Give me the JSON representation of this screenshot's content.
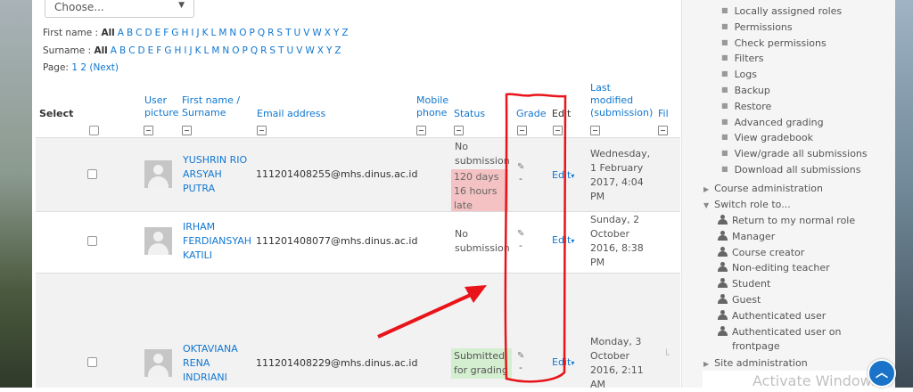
{
  "filter": {
    "select_text": "Choose..."
  },
  "initials": {
    "firstname_label": "First name :",
    "surname_label": "Surname :",
    "all": "All",
    "letters": [
      "A",
      "B",
      "C",
      "D",
      "E",
      "F",
      "G",
      "H",
      "I",
      "J",
      "K",
      "L",
      "M",
      "N",
      "O",
      "P",
      "Q",
      "R",
      "S",
      "T",
      "U",
      "V",
      "W",
      "X",
      "Y",
      "Z"
    ]
  },
  "paging": {
    "label": "Page:",
    "pages": "1 2",
    "next": "(Next)"
  },
  "table": {
    "headers": {
      "select": "Select",
      "user_picture_1": "User",
      "user_picture_2": "picture",
      "name_1": "First name /",
      "name_2": "Surname",
      "email": "Email address",
      "mobile_1": "Mobile",
      "mobile_2": "phone",
      "status": "Status",
      "grade": "Grade",
      "edit": "Edit",
      "modified_1": "Last",
      "modified_2": "modified",
      "modified_3": "(submission)",
      "file": "Fil"
    },
    "rows": [
      {
        "name": [
          "YUSHRIN RIO",
          "ARSYAH",
          "PUTRA"
        ],
        "email": "111201408255@mhs.dinus.ac.id",
        "status": [
          "No",
          "submission"
        ],
        "late": [
          "120 days",
          "16 hours",
          "late"
        ],
        "grade": "-",
        "edit": "Edit",
        "date": [
          "Wednesday,",
          "1 February",
          "2017, 4:04",
          "PM"
        ]
      },
      {
        "name": [
          "IRHAM",
          "FERDIANSYAH",
          "KATILI"
        ],
        "email": "111201408077@mhs.dinus.ac.id",
        "status": [
          "No",
          "submission"
        ],
        "grade": "-",
        "edit": "Edit",
        "date": [
          "Sunday, 2",
          "October",
          "2016, 8:38",
          "PM"
        ]
      },
      {
        "name": [
          "OKTAVIANA",
          "RENA",
          "INDRIANI"
        ],
        "email": "111201408229@mhs.dinus.ac.id",
        "submitted": [
          "Submitted",
          "for grading"
        ],
        "grade": "-",
        "edit": "Edit",
        "date": [
          "Monday, 3",
          "October",
          "2016, 2:11",
          "AM"
        ]
      }
    ]
  },
  "sidebar": {
    "bullets": [
      "Locally assigned roles",
      "Permissions",
      "Check permissions",
      "Filters",
      "Logs",
      "Backup",
      "Restore",
      "Advanced grading",
      "View gradebook",
      "View/grade all submissions",
      "Download all submissions"
    ],
    "course_admin": "Course administration",
    "switch_role": "Switch role to...",
    "roles": [
      "Return to my normal role",
      "Manager",
      "Course creator",
      "Non-editing teacher",
      "Student",
      "Guest",
      "Authenticated user",
      "Authenticated user on"
    ],
    "roles_extra": "frontpage",
    "site_admin": "Site administration"
  },
  "watermark": "Activate Windows",
  "colors": {
    "link": "#1177d1",
    "late_bg": "#f4c2c2",
    "submitted_bg": "#d4eed0",
    "annotation": "#e8141a"
  }
}
